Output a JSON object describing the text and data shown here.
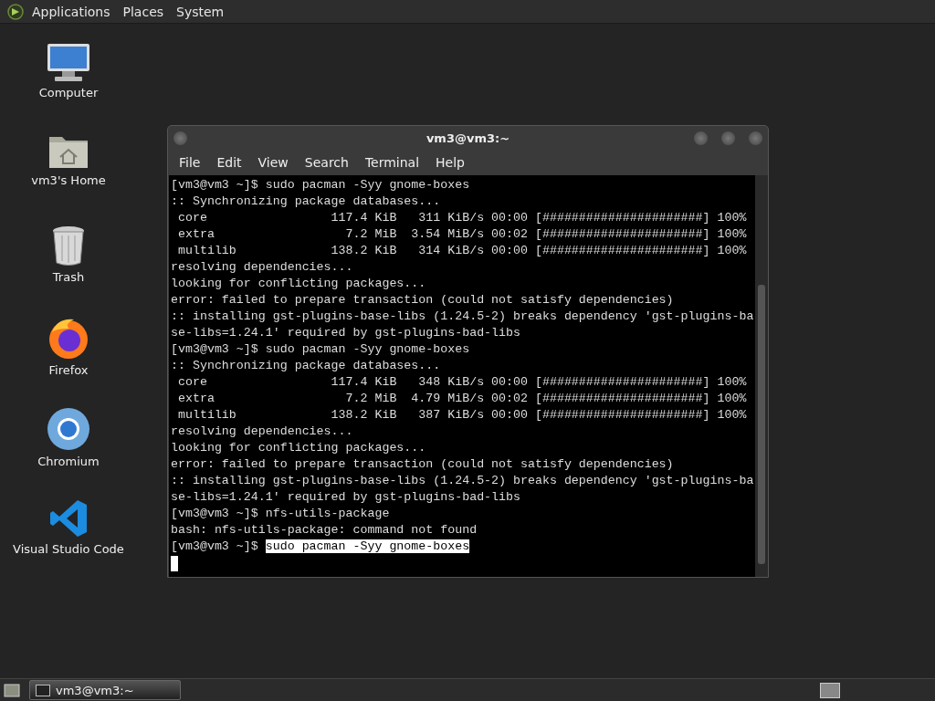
{
  "top_panel": {
    "menus": [
      "Applications",
      "Places",
      "System"
    ]
  },
  "desktop_icons": [
    {
      "kind": "computer",
      "label": "Computer"
    },
    {
      "kind": "home",
      "label": "vm3's Home"
    },
    {
      "kind": "trash",
      "label": "Trash"
    },
    {
      "kind": "firefox",
      "label": "Firefox"
    },
    {
      "kind": "chromium",
      "label": "Chromium"
    },
    {
      "kind": "vscode",
      "label": "Visual Studio Code"
    }
  ],
  "window": {
    "title": "vm3@vm3:~",
    "menu": [
      "File",
      "Edit",
      "View",
      "Search",
      "Terminal",
      "Help"
    ],
    "terminal": {
      "lines": [
        "[vm3@vm3 ~]$ sudo pacman -Syy gnome-boxes",
        ":: Synchronizing package databases...",
        " core                 117.4 KiB   311 KiB/s 00:00 [######################] 100%",
        " extra                  7.2 MiB  3.54 MiB/s 00:02 [######################] 100%",
        " multilib             138.2 KiB   314 KiB/s 00:00 [######################] 100%",
        "resolving dependencies...",
        "looking for conflicting packages...",
        "error: failed to prepare transaction (could not satisfy dependencies)",
        ":: installing gst-plugins-base-libs (1.24.5-2) breaks dependency 'gst-plugins-ba",
        "se-libs=1.24.1' required by gst-plugins-bad-libs",
        "[vm3@vm3 ~]$ sudo pacman -Syy gnome-boxes",
        ":: Synchronizing package databases...",
        " core                 117.4 KiB   348 KiB/s 00:00 [######################] 100%",
        " extra                  7.2 MiB  4.79 MiB/s 00:02 [######################] 100%",
        " multilib             138.2 KiB   387 KiB/s 00:00 [######################] 100%",
        "resolving dependencies...",
        "looking for conflicting packages...",
        "error: failed to prepare transaction (could not satisfy dependencies)",
        ":: installing gst-plugins-base-libs (1.24.5-2) breaks dependency 'gst-plugins-ba",
        "se-libs=1.24.1' required by gst-plugins-bad-libs",
        "[vm3@vm3 ~]$ nfs-utils-package",
        "bash: nfs-utils-package: command not found"
      ],
      "prompt": "[vm3@vm3 ~]$ ",
      "selected_text": "sudo pacman -Syy gnome-boxes"
    }
  },
  "taskbar": {
    "tasks": [
      {
        "label": "vm3@vm3:~",
        "selected": true
      }
    ]
  }
}
